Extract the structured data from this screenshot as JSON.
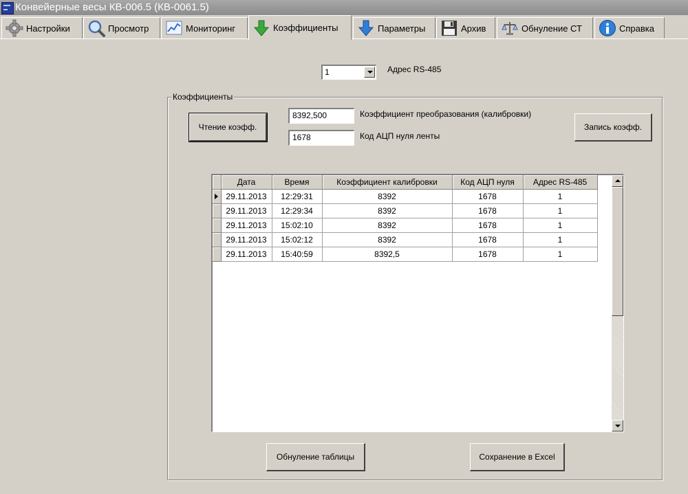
{
  "window": {
    "title": "Конвейерные весы КВ-006.5 (КВ-0061.5)"
  },
  "tabs": [
    {
      "label": "Настройки",
      "icon": "gear-icon"
    },
    {
      "label": "Просмотр",
      "icon": "magnifier-icon"
    },
    {
      "label": "Мониторинг",
      "icon": "chart-icon"
    },
    {
      "label": "Коэффициенты",
      "icon": "arrow-down-green-icon",
      "active": true
    },
    {
      "label": "Параметры",
      "icon": "arrow-down-blue-icon"
    },
    {
      "label": "Архив",
      "icon": "floppy-disk-icon"
    },
    {
      "label": "Обнуление СТ",
      "icon": "scale-reset-icon"
    },
    {
      "label": "Справка",
      "icon": "info-icon"
    }
  ],
  "address": {
    "value": "1",
    "label": "Адрес RS-485"
  },
  "coefficients": {
    "group_title": "Коэффициенты",
    "read_button": "Чтение коэфф.",
    "write_button": "Запись коэфф.",
    "calibration_value": "8392,500",
    "calibration_label": "Коэффициент преобразования (калибровки)",
    "zero_value": "1678",
    "zero_label": "Код АЦП нуля ленты"
  },
  "table": {
    "columns": [
      "Дата",
      "Время",
      "Коэффициент калибровки",
      "Код АЦП нуля",
      "Адрес RS-485"
    ],
    "rows": [
      [
        "29.11.2013",
        "12:29:31",
        "8392",
        "1678",
        "1"
      ],
      [
        "29.11.2013",
        "12:29:34",
        "8392",
        "1678",
        "1"
      ],
      [
        "29.11.2013",
        "15:02:10",
        "8392",
        "1678",
        "1"
      ],
      [
        "29.11.2013",
        "15:02:12",
        "8392",
        "1678",
        "1"
      ],
      [
        "29.11.2013",
        "15:40:59",
        "8392,5",
        "1678",
        "1"
      ]
    ]
  },
  "buttons": {
    "clear_table": "Обнуление таблицы",
    "save_excel": "Сохранение в Excel"
  },
  "colors": {
    "window_bg": "#d4d0c8",
    "titlebar_bg": "#9c9c9c",
    "icon_green": "#3aa83a",
    "icon_blue": "#2f7fd8"
  }
}
